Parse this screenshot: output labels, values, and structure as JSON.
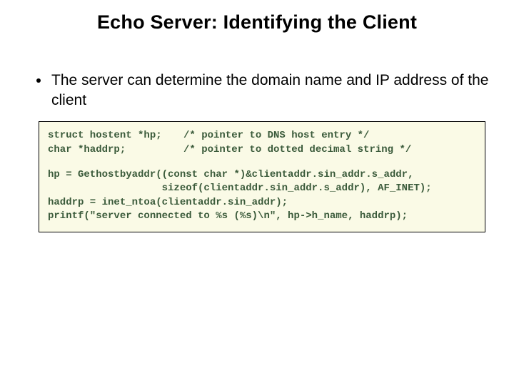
{
  "title": "Echo Server: Identifying the Client",
  "bullet": "The server can determine the domain name and IP address of the client",
  "code": {
    "decl1_left": "struct hostent *hp;",
    "decl1_right": "/* pointer to DNS host entry */",
    "decl2_left": "char *haddrp;",
    "decl2_right": "/* pointer to dotted decimal string */",
    "body": "hp = Gethostbyaddr((const char *)&clientaddr.sin_addr.s_addr,\n                   sizeof(clientaddr.sin_addr.s_addr), AF_INET);\nhaddrp = inet_ntoa(clientaddr.sin_addr);\nprintf(\"server connected to %s (%s)\\n\", hp->h_name, haddrp);"
  }
}
